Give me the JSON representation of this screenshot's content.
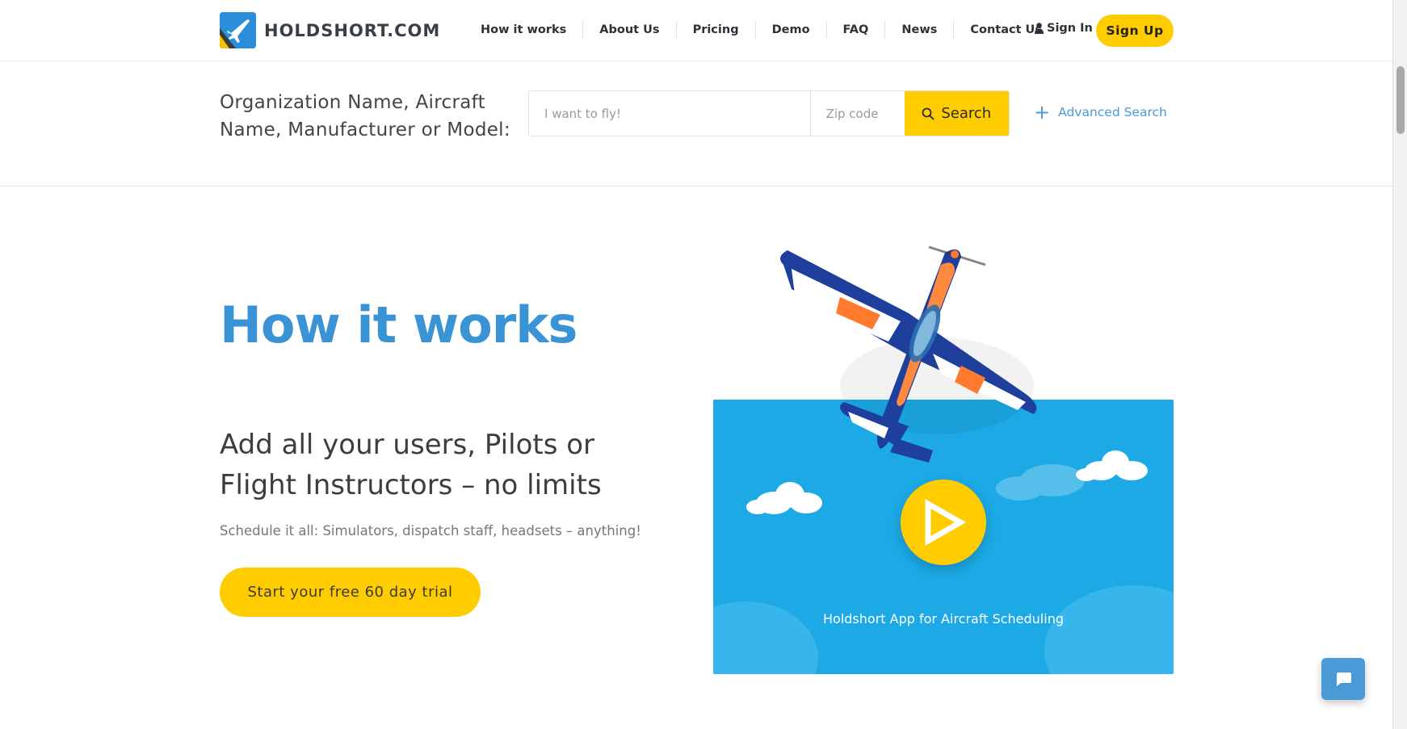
{
  "brand": {
    "name": "HOLDSHORT.COM"
  },
  "nav": {
    "items": [
      {
        "label": "How it works"
      },
      {
        "label": "About Us"
      },
      {
        "label": "Pricing"
      },
      {
        "label": "Demo"
      },
      {
        "label": "FAQ"
      },
      {
        "label": "News"
      },
      {
        "label": "Contact Us"
      }
    ],
    "sign_in": "Sign In",
    "sign_up": "Sign Up"
  },
  "search": {
    "label": "Organization Name, Aircraft Name, Manufacturer or Model:",
    "fly_placeholder": "I want to fly!",
    "zip_placeholder": "Zip code",
    "button": "Search",
    "advanced": "Advanced Search"
  },
  "hero": {
    "title": "How it works",
    "subtitle": "Add all your users, Pilots or Flight Instructors – no limits",
    "small": "Schedule it all: Simulators, dispatch staff, headsets – anything!",
    "cta": "Start your free 60 day trial"
  },
  "video": {
    "caption": "Holdshort App for Aircraft Scheduling"
  },
  "colors": {
    "accent_yellow": "#ffcc00",
    "brand_blue": "#3a93d5",
    "link_blue": "#4a9ad8",
    "video_bg": "#1ca9e5"
  },
  "icons": {
    "user": "user-icon",
    "search": "search-icon",
    "plus": "plus-icon",
    "play": "play-icon",
    "chat": "chat-icon"
  }
}
